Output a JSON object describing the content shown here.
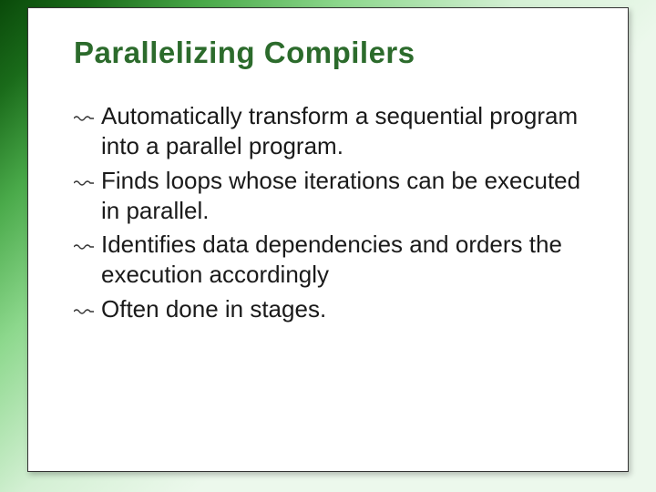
{
  "slide": {
    "title": "Parallelizing Compilers",
    "bullets": [
      "Automatically transform a sequential program into a parallel program.",
      "Finds loops whose iterations can be executed in parallel.",
      "Identifies data dependencies and orders the execution accordingly",
      "Often done in stages."
    ]
  }
}
